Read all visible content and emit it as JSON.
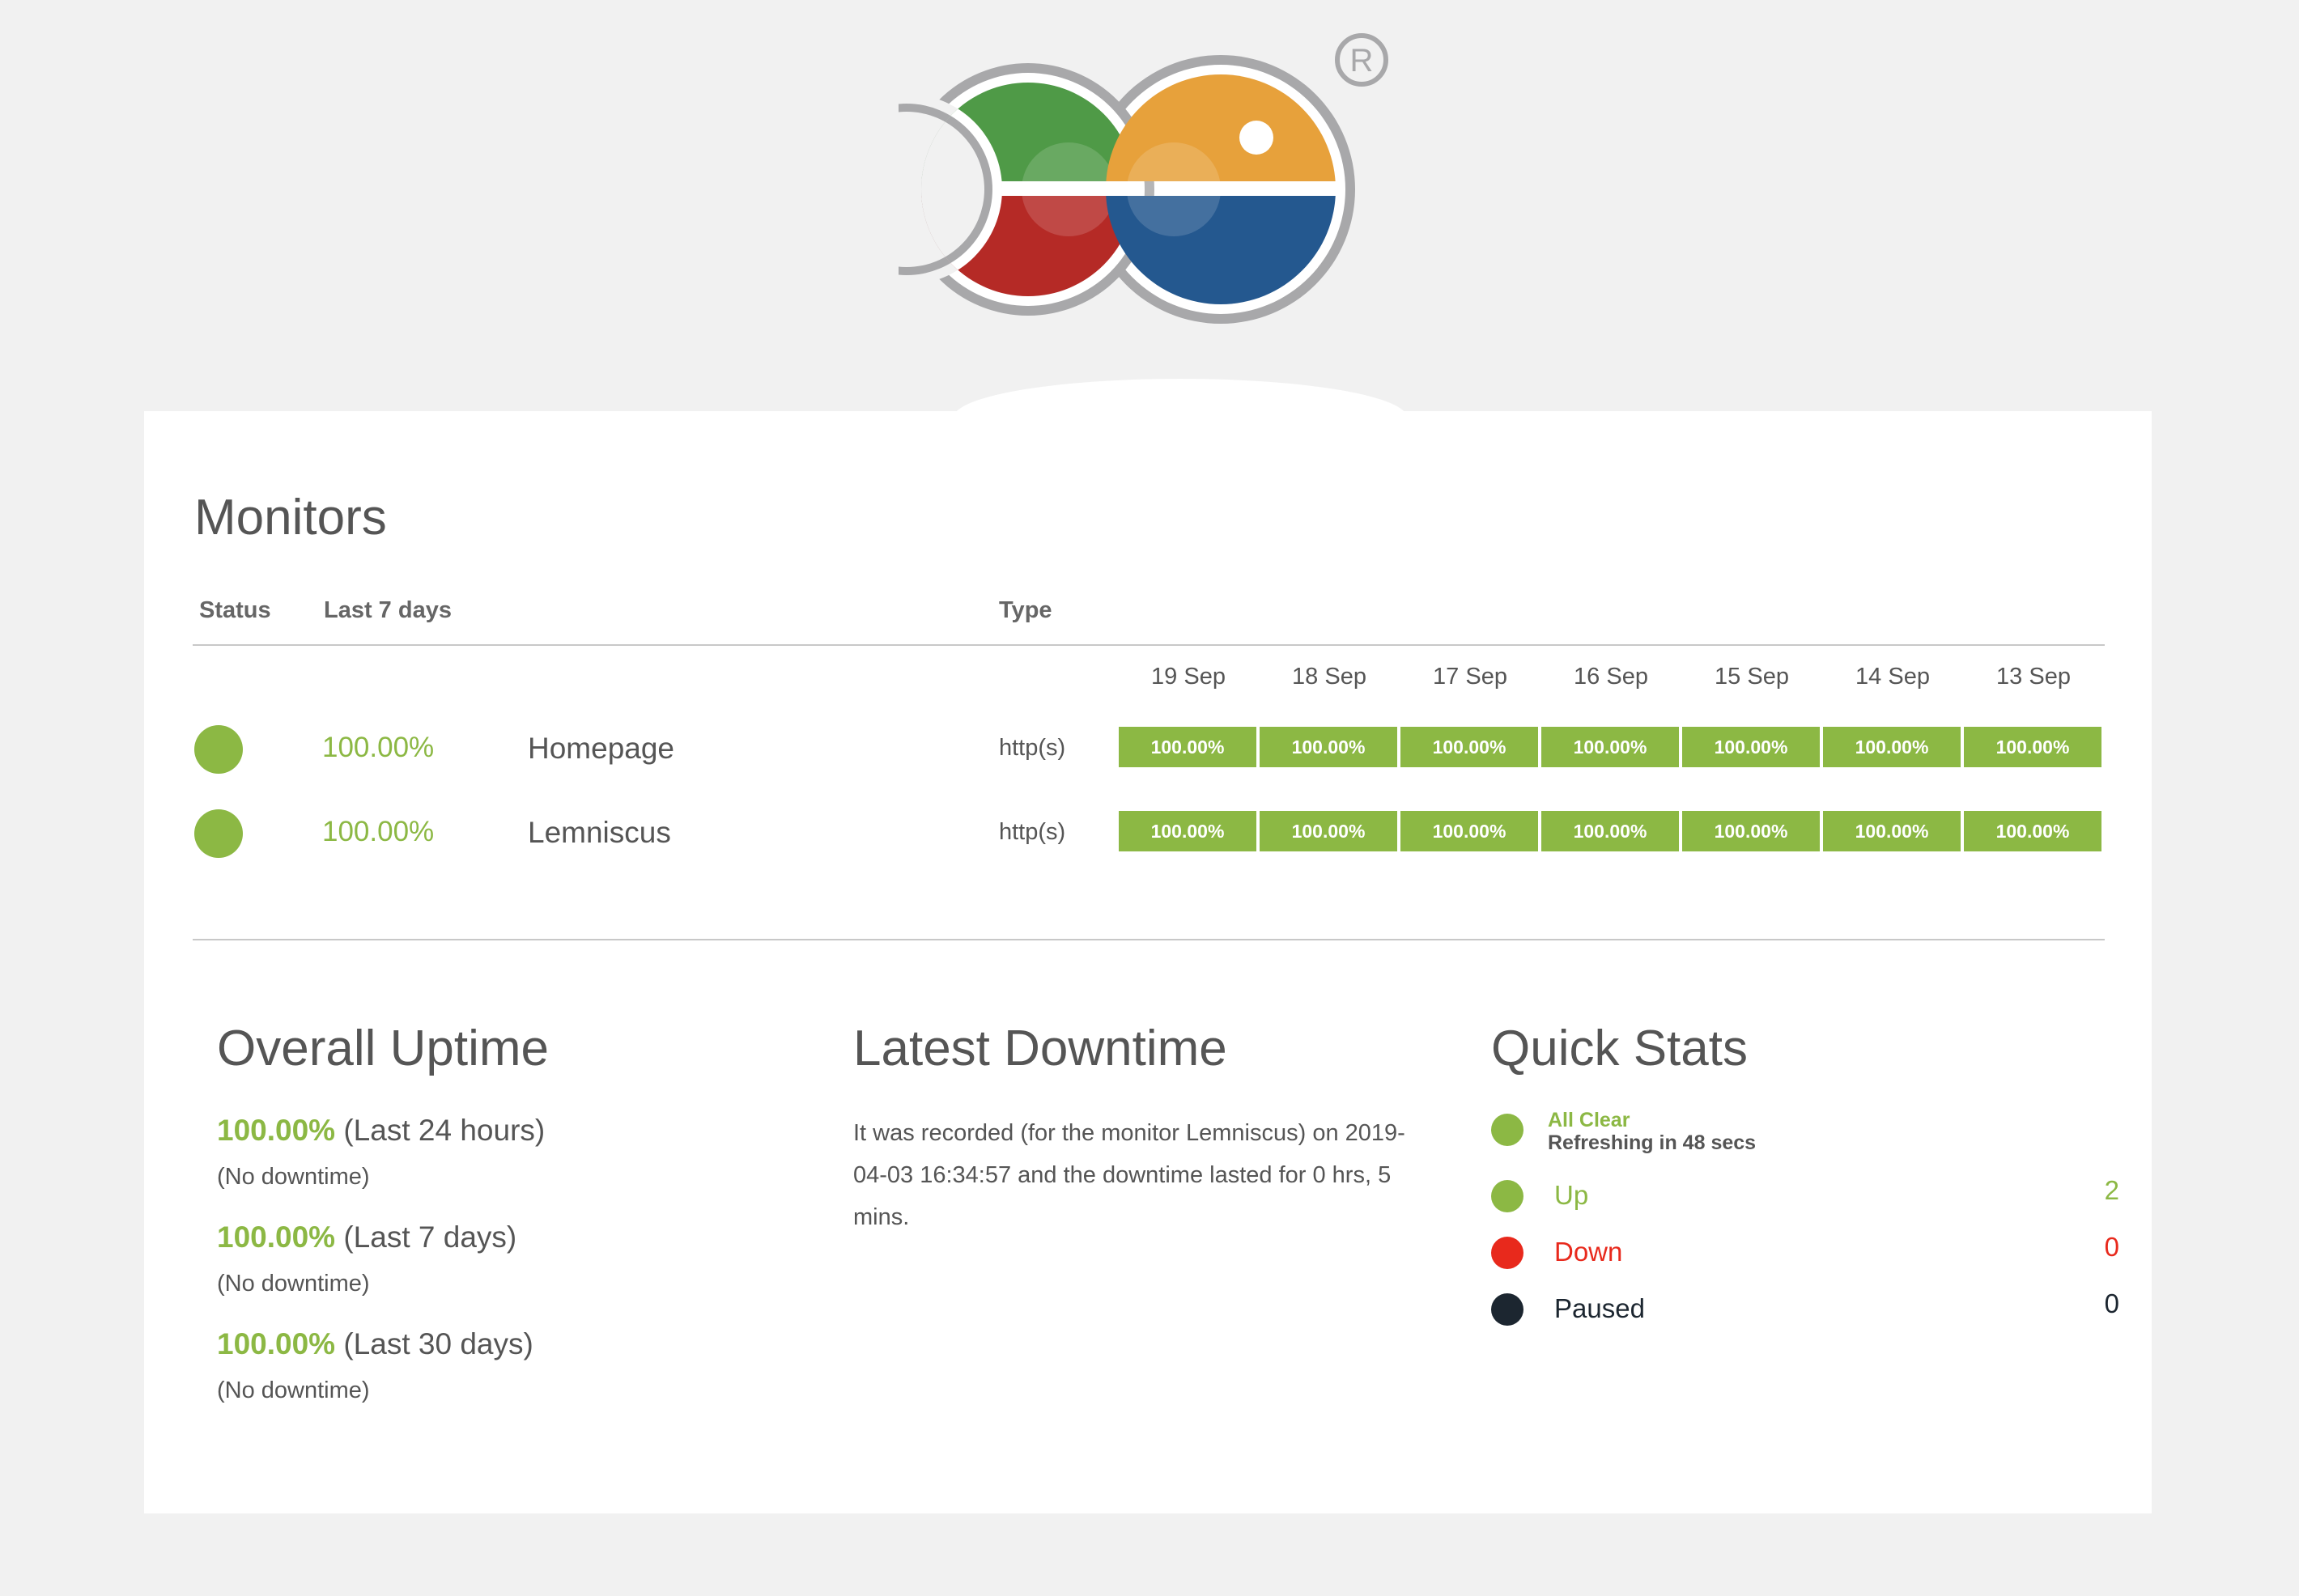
{
  "colors": {
    "accent_green": "#8cb844",
    "down_red": "#e8291c",
    "paused_black": "#1c2630",
    "background": "#f1f1f1"
  },
  "logo": {
    "registered_mark": "®"
  },
  "monitors": {
    "title": "Monitors",
    "headers": {
      "status": "Status",
      "last7": "Last 7 days",
      "type": "Type"
    },
    "dates": [
      "19 Sep",
      "18 Sep",
      "17 Sep",
      "16 Sep",
      "15 Sep",
      "14 Sep",
      "13 Sep"
    ],
    "rows": [
      {
        "status": "up",
        "uptime": "100.00%",
        "name": "Homepage",
        "type": "http(s)",
        "days": [
          "100.00%",
          "100.00%",
          "100.00%",
          "100.00%",
          "100.00%",
          "100.00%",
          "100.00%"
        ]
      },
      {
        "status": "up",
        "uptime": "100.00%",
        "name": "Lemniscus",
        "type": "http(s)",
        "days": [
          "100.00%",
          "100.00%",
          "100.00%",
          "100.00%",
          "100.00%",
          "100.00%",
          "100.00%"
        ]
      }
    ]
  },
  "overall_uptime": {
    "title": "Overall Uptime",
    "items": [
      {
        "pct": "100.00%",
        "period": "(Last 24 hours)",
        "note": "(No downtime)"
      },
      {
        "pct": "100.00%",
        "period": "(Last 7 days)",
        "note": "(No downtime)"
      },
      {
        "pct": "100.00%",
        "period": "(Last 30 days)",
        "note": "(No downtime)"
      }
    ]
  },
  "latest_downtime": {
    "title": "Latest Downtime",
    "text": "It was recorded (for the monitor Lemniscus) on 2019-04-03 16:34:57 and the downtime lasted for 0 hrs, 5 mins."
  },
  "quick_stats": {
    "title": "Quick Stats",
    "all_clear": "All Clear",
    "refreshing": "Refreshing in 48 secs",
    "up_label": "Up",
    "up_count": "2",
    "down_label": "Down",
    "down_count": "0",
    "paused_label": "Paused",
    "paused_count": "0"
  }
}
